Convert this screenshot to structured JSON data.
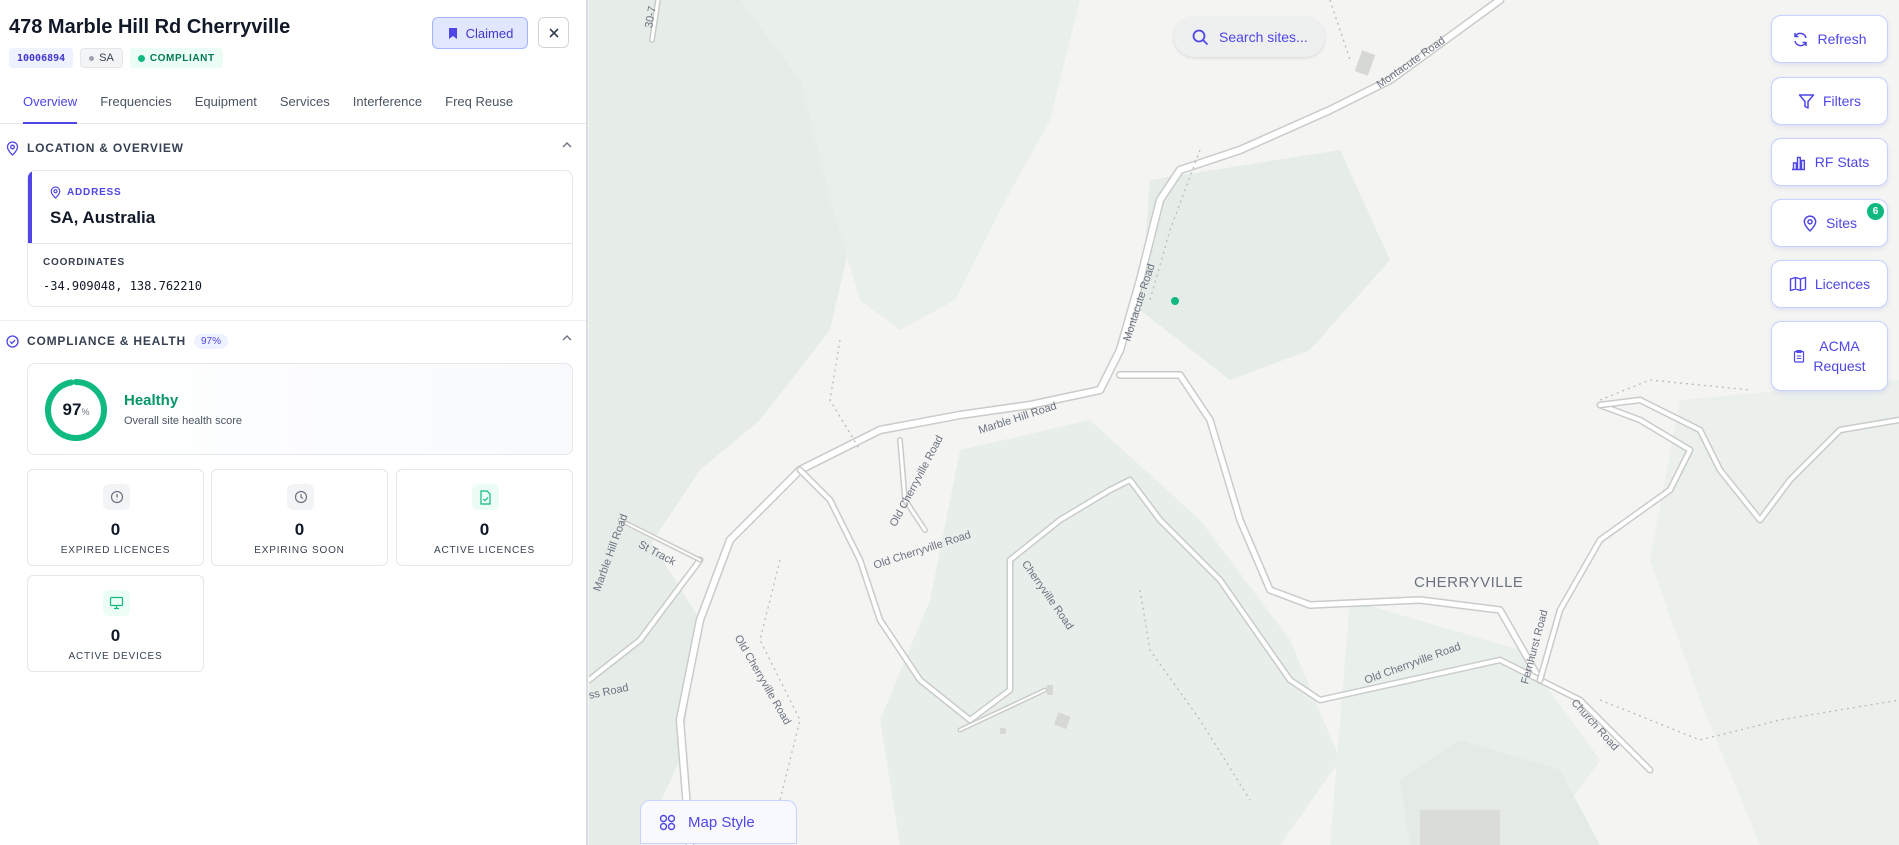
{
  "site": {
    "title": "478 Marble Hill Rd Cherryville",
    "id": "10006894",
    "state": "SA",
    "compliance": "COMPLIANT",
    "claimed_label": "Claimed"
  },
  "tabs": [
    "Overview",
    "Frequencies",
    "Equipment",
    "Services",
    "Interference",
    "Freq Reuse"
  ],
  "location": {
    "section_label": "LOCATION & OVERVIEW",
    "address_label": "ADDRESS",
    "address": "SA, Australia",
    "coordinates_label": "COORDINATES",
    "coordinates": "-34.909048, 138.762210"
  },
  "compliance": {
    "section_label": "COMPLIANCE & HEALTH",
    "percent_chip": "97%",
    "score": "97",
    "score_unit": "%",
    "score_fraction": 0.97,
    "status": "Healthy",
    "status_sub": "Overall site health score",
    "stats": [
      {
        "value": "0",
        "label": "EXPIRED LICENCES",
        "icon": "alert-circle-icon"
      },
      {
        "value": "0",
        "label": "EXPIRING SOON",
        "icon": "clock-icon"
      },
      {
        "value": "0",
        "label": "ACTIVE LICENCES",
        "icon": "file-check-icon"
      },
      {
        "value": "0",
        "label": "ACTIVE DEVICES",
        "icon": "monitor-icon"
      }
    ]
  },
  "map": {
    "search_placeholder": "Search sites...",
    "buttons": {
      "refresh": "Refresh",
      "filters": "Filters",
      "rf_stats": "RF Stats",
      "sites": "Sites",
      "sites_count": "6",
      "licences": "Licences",
      "acma_line1": "ACMA",
      "acma_line2": "Request"
    },
    "map_style": "Map Style",
    "place_label": "CHERRYVILLE",
    "roads": {
      "montacute_top": "Montacute Road",
      "montacute_mid": "Montacute Road",
      "marble_hill_top": "Marble Hill Road",
      "marble_hill_left": "Marble Hill Road",
      "old_cherryville_1": "Old Cherryville Road",
      "old_cherryville_2": "Old Cherryville Road",
      "old_cherryville_3": "Old Cherryville Road",
      "cherryville_road": "Cherryville Road",
      "fernhurst": "Fernhurst Road",
      "church": "Church Road",
      "track": "St Track",
      "ss_road": "ss Road",
      "top_left": "30-7"
    }
  },
  "colors": {
    "accent": "#4f46e5",
    "healthy": "#10b981",
    "map_bg": "#f4f4f2",
    "forest": "#e8eee9"
  }
}
